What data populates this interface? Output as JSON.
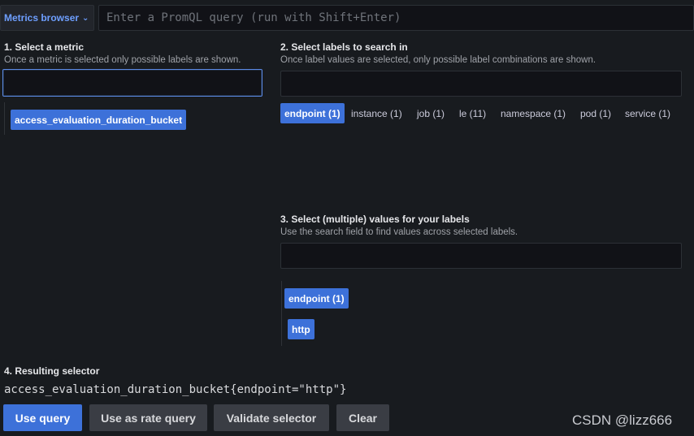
{
  "topbar": {
    "metrics_browser_label": "Metrics browser",
    "query_placeholder": "Enter a PromQL query (run with Shift+Enter)"
  },
  "step1": {
    "title": "1. Select a metric",
    "description": "Once a metric is selected only possible labels are shown.",
    "search_value": "",
    "metrics": [
      "access_evaluation_duration_bucket"
    ]
  },
  "step2": {
    "title": "2. Select labels to search in",
    "description": "Once label values are selected, only possible label combinations are shown.",
    "search_value": "",
    "labels": [
      {
        "label": "endpoint (1)",
        "selected": true
      },
      {
        "label": "instance (1)",
        "selected": false
      },
      {
        "label": "job (1)",
        "selected": false
      },
      {
        "label": "le (11)",
        "selected": false
      },
      {
        "label": "namespace (1)",
        "selected": false
      },
      {
        "label": "pod (1)",
        "selected": false
      },
      {
        "label": "service (1)",
        "selected": false
      }
    ]
  },
  "step3": {
    "title": "3. Select (multiple) values for your labels",
    "description": "Use the search field to find values across selected labels.",
    "search_value": "",
    "label_name": "endpoint (1)",
    "values": [
      "http"
    ]
  },
  "step4": {
    "title": "4. Resulting selector",
    "selector": "access_evaluation_duration_bucket{endpoint=\"http\"}"
  },
  "buttons": {
    "use_query": "Use query",
    "use_rate": "Use as rate query",
    "validate": "Validate selector",
    "clear": "Clear"
  },
  "watermark": "CSDN @lizz666",
  "colors": {
    "background": "#181b1f",
    "accent": "#3d71d9",
    "link": "#6e9fff",
    "input_bg": "#111217"
  }
}
